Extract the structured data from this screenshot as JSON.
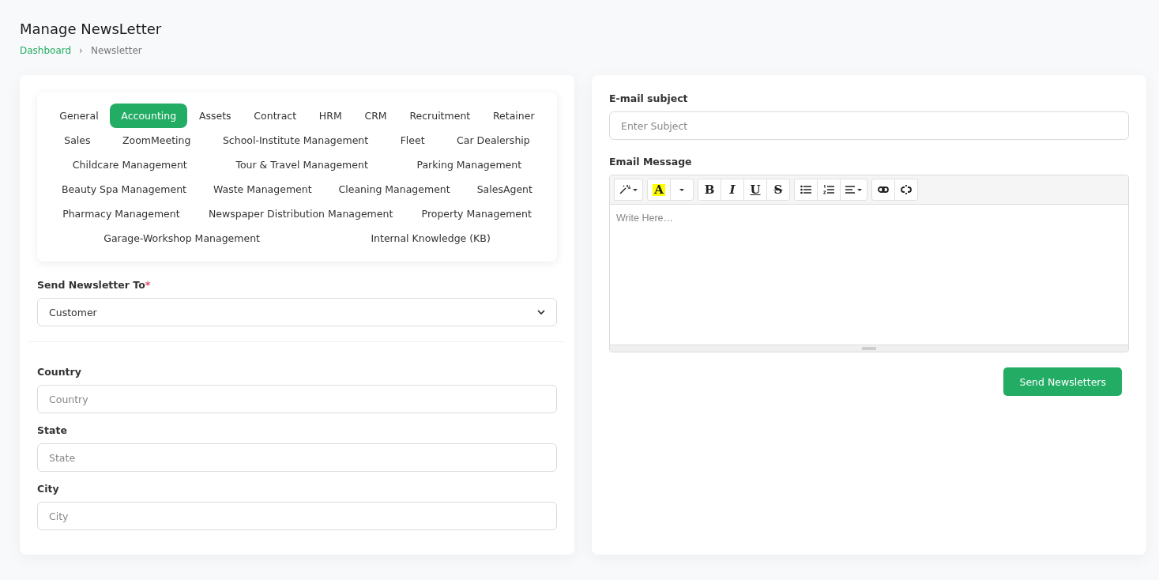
{
  "page_title": "Manage NewsLetter",
  "breadcrumb": [
    {
      "label": "Dashboard",
      "kind": "link"
    },
    {
      "label": "Newsletter",
      "kind": "current"
    }
  ],
  "breadcrumb_separator": "›",
  "tab_rows": [
    [
      {
        "label": "General",
        "selected": false
      },
      {
        "label": "Accounting",
        "selected": true
      },
      {
        "label": "Assets",
        "selected": false
      },
      {
        "label": "Contract",
        "selected": false
      },
      {
        "label": "HRM",
        "selected": false
      },
      {
        "label": "CRM",
        "selected": false
      },
      {
        "label": "Recruitment",
        "selected": false
      },
      {
        "label": "Retainer",
        "selected": false
      }
    ],
    [
      {
        "label": "Sales",
        "selected": false
      },
      {
        "label": "ZoomMeeting",
        "selected": false
      },
      {
        "label": "School-Institute Management",
        "selected": false
      },
      {
        "label": "Fleet",
        "selected": false
      },
      {
        "label": "Car Dealership",
        "selected": false
      }
    ],
    [
      {
        "label": "Childcare Management",
        "selected": false
      },
      {
        "label": "Tour & Travel Management",
        "selected": false
      },
      {
        "label": "Parking Management",
        "selected": false
      }
    ],
    [
      {
        "label": "Beauty Spa Management",
        "selected": false
      },
      {
        "label": "Waste Management",
        "selected": false
      },
      {
        "label": "Cleaning Management",
        "selected": false
      },
      {
        "label": "SalesAgent",
        "selected": false
      }
    ],
    [
      {
        "label": "Pharmacy Management",
        "selected": false
      },
      {
        "label": "Newspaper Distribution Management",
        "selected": false
      },
      {
        "label": "Property Management",
        "selected": false
      }
    ],
    [
      {
        "label": "Garage-Workshop Management",
        "selected": false
      },
      {
        "label": "Internal Knowledge (KB)",
        "selected": false
      }
    ]
  ],
  "send_to": {
    "label": "Send Newsletter To",
    "required_mark": "*",
    "value": "Customer"
  },
  "location_fields": [
    {
      "label": "Country",
      "placeholder": "Country"
    },
    {
      "label": "State",
      "placeholder": "State"
    },
    {
      "label": "City",
      "placeholder": "City"
    }
  ],
  "subject": {
    "label": "E-mail subject",
    "placeholder": "Enter Subject"
  },
  "message": {
    "label": "Email Message",
    "placeholder": "Write Here…",
    "toolbar": [
      [
        {
          "kind": "wand"
        }
      ],
      [
        {
          "kind": "highlight",
          "label": "A"
        },
        {
          "kind": "caret"
        }
      ],
      [
        {
          "kind": "bold",
          "label": "B"
        },
        {
          "kind": "italic",
          "label": "I"
        },
        {
          "kind": "underline",
          "label": "U"
        },
        {
          "kind": "strike",
          "label": "S"
        }
      ],
      [
        {
          "kind": "bullets"
        },
        {
          "kind": "numbers"
        },
        {
          "kind": "align"
        }
      ],
      [
        {
          "kind": "link"
        },
        {
          "kind": "unlink"
        }
      ]
    ]
  },
  "send_button": "Send Newsletters"
}
